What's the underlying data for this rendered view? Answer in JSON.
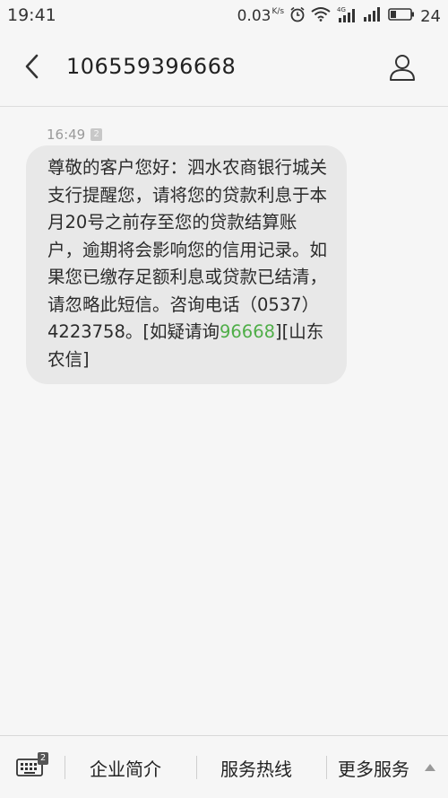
{
  "status_bar": {
    "time": "19:41",
    "net_speed": "0.03",
    "net_speed_unit": "K/s",
    "battery_level": "24",
    "icons": [
      "alarm-icon",
      "wifi-icon",
      "signal-4g-icon",
      "signal-icon",
      "battery-icon"
    ]
  },
  "header": {
    "back_icon": "chevron-left-icon",
    "contact": "106559396668",
    "contact_icon": "person-icon"
  },
  "message": {
    "time": "16:49",
    "sim_slot": "2",
    "text_before_link": "尊敬的客户您好：泗水农商银行城关支行提醒您，请将您的贷款利息于本月20号之前存至您的贷款结算账户，逾期将会影响您的信用记录。如果您已缴存足额利息或贷款已结清，请忽略此短信。咨询电话（0537）4223758。[如疑请询",
    "link_text": "96668",
    "text_after_link": "][山东农信]",
    "link_color": "#4fae48"
  },
  "bottom_menu": {
    "keyboard_icon": "keyboard-icon",
    "keyboard_badge": "2",
    "items": [
      {
        "label": "企业简介"
      },
      {
        "label": "服务热线"
      },
      {
        "label": "更多服务"
      }
    ],
    "more_icon": "triangle-up-icon"
  }
}
